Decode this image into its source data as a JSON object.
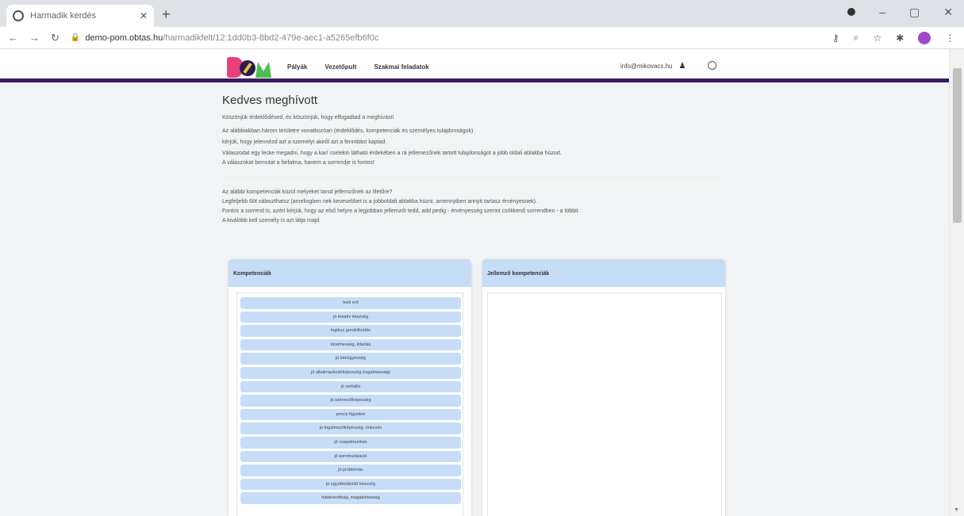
{
  "browser": {
    "tab_title": "Harmadik kerdés",
    "url_host": "demo-pom.obtas.hu",
    "url_path": "/harmadikfelt/12:1dd0b3-8bd2-479e-aec1-a5265efb6f0c"
  },
  "app": {
    "nav": [
      "Pályák",
      "Vezetőpult",
      "Szakmai feladatok"
    ],
    "user_email": "info@mikovacs.hu"
  },
  "page": {
    "title": "Kedves meghívott",
    "intro": [
      "Köszönjük érdeklődésed, és köszönjük, hogy elfogadtad a meghívást!",
      "Az alábbiakban három területre vonatkozóan (érdeklődés, kompetenciák és személyes tulajdonságok)",
      "kérjük, hogy jelennézd azt a személyt akiről azt a fenntitást kaptad.",
      "Válaszodat egy lecke megadni, hogy a kar/ cselekin látható érdekében a rá jellemezőnek tartott tulajdonságot a jobb oldali ablakba húzod.",
      "A válaszokat bemutat a farfalma, hanem a sorrendje is fontos!"
    ],
    "question": [
      "Az alábbi kompetenciák közül melyeket tarsd jellemzőnek az illetőre?",
      "Legfeljebb 6öt választhatsz (ameliogben nek kevesebbet is a jobboldali ablakba húzni, amennyiben annyit tartasz érvényesnek).",
      "Fontos a sorrend is, azért kérjük, hogy az első helyre a legjobban jellemzőt tedd, add pedig - érvényesség szerint csökkenő sorrendben - a többit.",
      "A kiválóbb kell személy is azt látja majd."
    ]
  },
  "left_panel": {
    "header": "Kompetenciák",
    "items": [
      "testi erő",
      "jó kreatív készség",
      "logikus gondolkodás",
      "türelmesség, kitartás",
      "jó kézügyesség",
      "jó alkalmazkodóképesség (rugalmasság)",
      "jó verbális",
      "jó szervezőképesség",
      "precíz figyelem",
      "jó fogalmazóképesség, önkezés",
      "jó csapatmunkás",
      "jó kommunikáció",
      "jó problémás",
      "jó együttműködő készség",
      "határozottság, magabiztosság"
    ]
  },
  "right_panel": {
    "header": "Jellemző kompetenciák"
  }
}
